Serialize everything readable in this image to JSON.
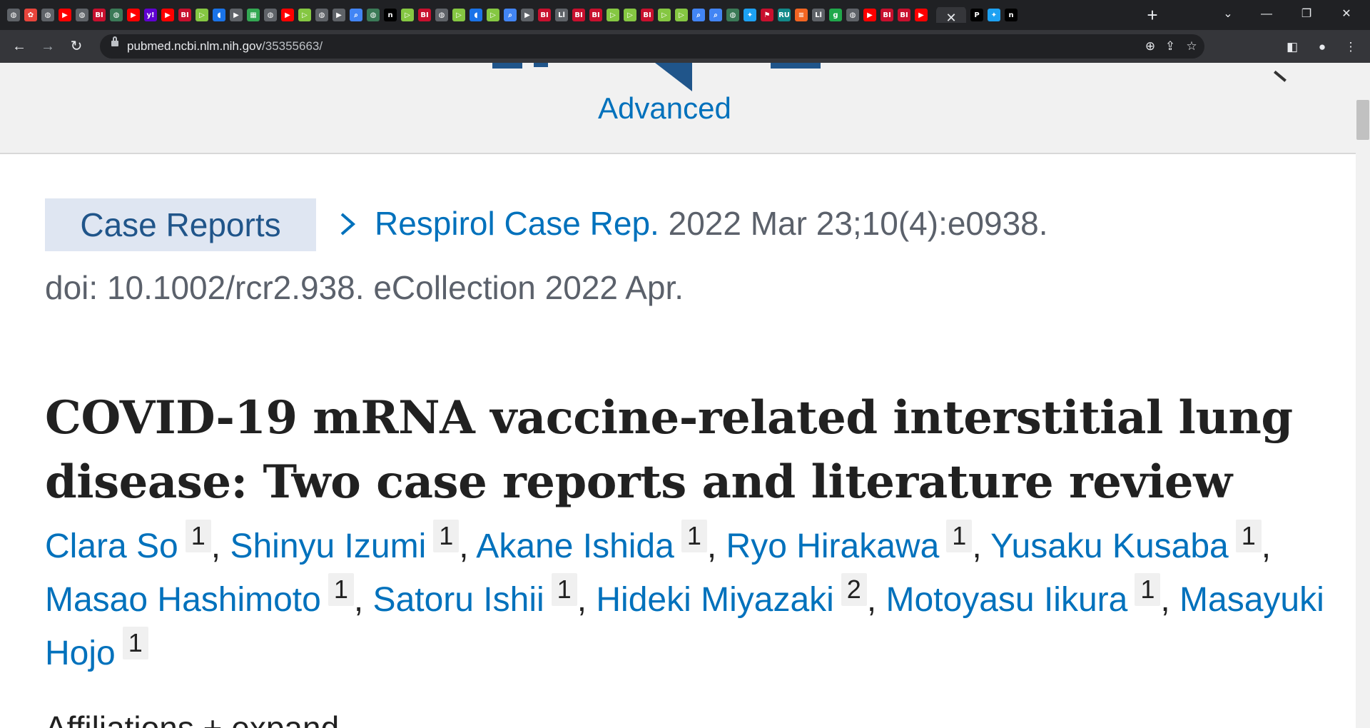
{
  "browser": {
    "favicons": [
      {
        "icon": "globe-icon",
        "color": "#5f6368",
        "glyph": "◍"
      },
      {
        "icon": "pinwheel-icon",
        "color": "#e8453c",
        "glyph": "✿"
      },
      {
        "icon": "globe-icon",
        "color": "#5f6368",
        "glyph": "◍"
      },
      {
        "icon": "youtube-icon",
        "color": "#ff0000",
        "glyph": "▶"
      },
      {
        "icon": "globe-icon",
        "color": "#5f6368",
        "glyph": "◍"
      },
      {
        "icon": "bi-icon",
        "color": "#c8102e",
        "glyph": "BI"
      },
      {
        "icon": "globe-icon",
        "color": "#3b7a57",
        "glyph": "◍"
      },
      {
        "icon": "youtube-icon",
        "color": "#ff0000",
        "glyph": "▶"
      },
      {
        "icon": "yahoo-icon",
        "color": "#6001d2",
        "glyph": "y!"
      },
      {
        "icon": "youtube-icon",
        "color": "#ff0000",
        "glyph": "▶"
      },
      {
        "icon": "bi-icon",
        "color": "#c8102e",
        "glyph": "BI"
      },
      {
        "icon": "rumble-icon",
        "color": "#85c742",
        "glyph": "▷"
      },
      {
        "icon": "shield-icon",
        "color": "#1a73e8",
        "glyph": "◖"
      },
      {
        "icon": "bookmark-icon",
        "color": "#5f6368",
        "glyph": "▶"
      },
      {
        "icon": "map-icon",
        "color": "#34a853",
        "glyph": "▦"
      },
      {
        "icon": "globe-icon",
        "color": "#5f6368",
        "glyph": "◍"
      },
      {
        "icon": "youtube-icon",
        "color": "#ff0000",
        "glyph": "▶"
      },
      {
        "icon": "rumble-icon",
        "color": "#85c742",
        "glyph": "▷"
      },
      {
        "icon": "globe-icon",
        "color": "#5f6368",
        "glyph": "◍"
      },
      {
        "icon": "bookmark-icon",
        "color": "#5f6368",
        "glyph": "▶"
      },
      {
        "icon": "search-icon",
        "color": "#4285f4",
        "glyph": "⌕"
      },
      {
        "icon": "globe-icon",
        "color": "#3b7a57",
        "glyph": "◍"
      },
      {
        "icon": "n-icon",
        "color": "#000000",
        "glyph": "n"
      },
      {
        "icon": "rumble-icon",
        "color": "#85c742",
        "glyph": "▷"
      },
      {
        "icon": "bi-icon",
        "color": "#c8102e",
        "glyph": "BI"
      },
      {
        "icon": "globe-icon",
        "color": "#5f6368",
        "glyph": "◍"
      },
      {
        "icon": "rumble-icon",
        "color": "#85c742",
        "glyph": "▷"
      },
      {
        "icon": "shield-icon",
        "color": "#1a73e8",
        "glyph": "◖"
      },
      {
        "icon": "rumble-icon",
        "color": "#85c742",
        "glyph": "▷"
      },
      {
        "icon": "search-icon",
        "color": "#4285f4",
        "glyph": "⌕"
      },
      {
        "icon": "bookmark-icon",
        "color": "#5f6368",
        "glyph": "▶"
      },
      {
        "icon": "bi-icon",
        "color": "#c8102e",
        "glyph": "BI"
      },
      {
        "icon": "ll-icon",
        "color": "#5f6368",
        "glyph": "Ll"
      },
      {
        "icon": "bi-icon",
        "color": "#c8102e",
        "glyph": "BI"
      },
      {
        "icon": "bi-icon",
        "color": "#c8102e",
        "glyph": "BI"
      },
      {
        "icon": "rumble-icon",
        "color": "#85c742",
        "glyph": "▷"
      },
      {
        "icon": "rumble-icon",
        "color": "#85c742",
        "glyph": "▷"
      },
      {
        "icon": "bi-icon",
        "color": "#c8102e",
        "glyph": "BI"
      },
      {
        "icon": "rumble-icon",
        "color": "#85c742",
        "glyph": "▷"
      },
      {
        "icon": "rumble-icon",
        "color": "#85c742",
        "glyph": "▷"
      },
      {
        "icon": "search-icon",
        "color": "#4285f4",
        "glyph": "⌕"
      },
      {
        "icon": "search-icon",
        "color": "#4285f4",
        "glyph": "⌕"
      },
      {
        "icon": "globe-icon",
        "color": "#3b7a57",
        "glyph": "◍"
      },
      {
        "icon": "twitter-icon",
        "color": "#1da1f2",
        "glyph": "✦"
      },
      {
        "icon": "flag-icon",
        "color": "#c8102e",
        "glyph": "⚑"
      },
      {
        "icon": "ru-icon",
        "color": "#138a8a",
        "glyph": "RU"
      },
      {
        "icon": "feed-icon",
        "color": "#f26522",
        "glyph": "≡"
      },
      {
        "icon": "ll-icon",
        "color": "#5f6368",
        "glyph": "Ll"
      },
      {
        "icon": "g-icon",
        "color": "#20a84b",
        "glyph": "g"
      },
      {
        "icon": "globe-icon",
        "color": "#5f6368",
        "glyph": "◍"
      },
      {
        "icon": "youtube-icon",
        "color": "#ff0000",
        "glyph": "▶"
      },
      {
        "icon": "bi-icon",
        "color": "#c8102e",
        "glyph": "BI"
      },
      {
        "icon": "bi-icon",
        "color": "#c8102e",
        "glyph": "BI"
      },
      {
        "icon": "youtube-icon",
        "color": "#ff0000",
        "glyph": "▶"
      }
    ],
    "after_active_favicons": [
      {
        "icon": "p-icon",
        "color": "#000000",
        "glyph": "P"
      },
      {
        "icon": "twitter-icon",
        "color": "#1da1f2",
        "glyph": "✦"
      },
      {
        "icon": "n-icon",
        "color": "#000000",
        "glyph": "n"
      }
    ],
    "active_tab_close": "✕",
    "new_tab": "+",
    "url_host": "pubmed.ncbi.nlm.nih.gov",
    "url_path": "/35355663/"
  },
  "header": {
    "advanced_link": "Advanced"
  },
  "article": {
    "type_badge": "Case Reports",
    "journal": "Respirol Case Rep.",
    "citation_rest": "2022 Mar 23;10(4):e0938.",
    "doi_line": "doi: 10.1002/rcr2.938. eCollection 2022 Apr.",
    "title": "COVID-19 mRNA vaccine-related interstitial lung disease: Two case reports and literature review",
    "authors": [
      {
        "name": "Clara So",
        "aff": "1"
      },
      {
        "name": "Shinyu Izumi",
        "aff": "1"
      },
      {
        "name": "Akane Ishida",
        "aff": "1"
      },
      {
        "name": "Ryo Hirakawa",
        "aff": "1"
      },
      {
        "name": "Yusaku Kusaba",
        "aff": "1"
      },
      {
        "name": "Masao Hashimoto",
        "aff": "1"
      },
      {
        "name": "Satoru Ishii",
        "aff": "1"
      },
      {
        "name": "Hideki Miyazaki",
        "aff": "2"
      },
      {
        "name": "Motoyasu Iikura",
        "aff": "1"
      },
      {
        "name": "Masayuki Hojo",
        "aff": "1"
      }
    ],
    "affiliations_cutoff": "Affiliations + expand"
  }
}
